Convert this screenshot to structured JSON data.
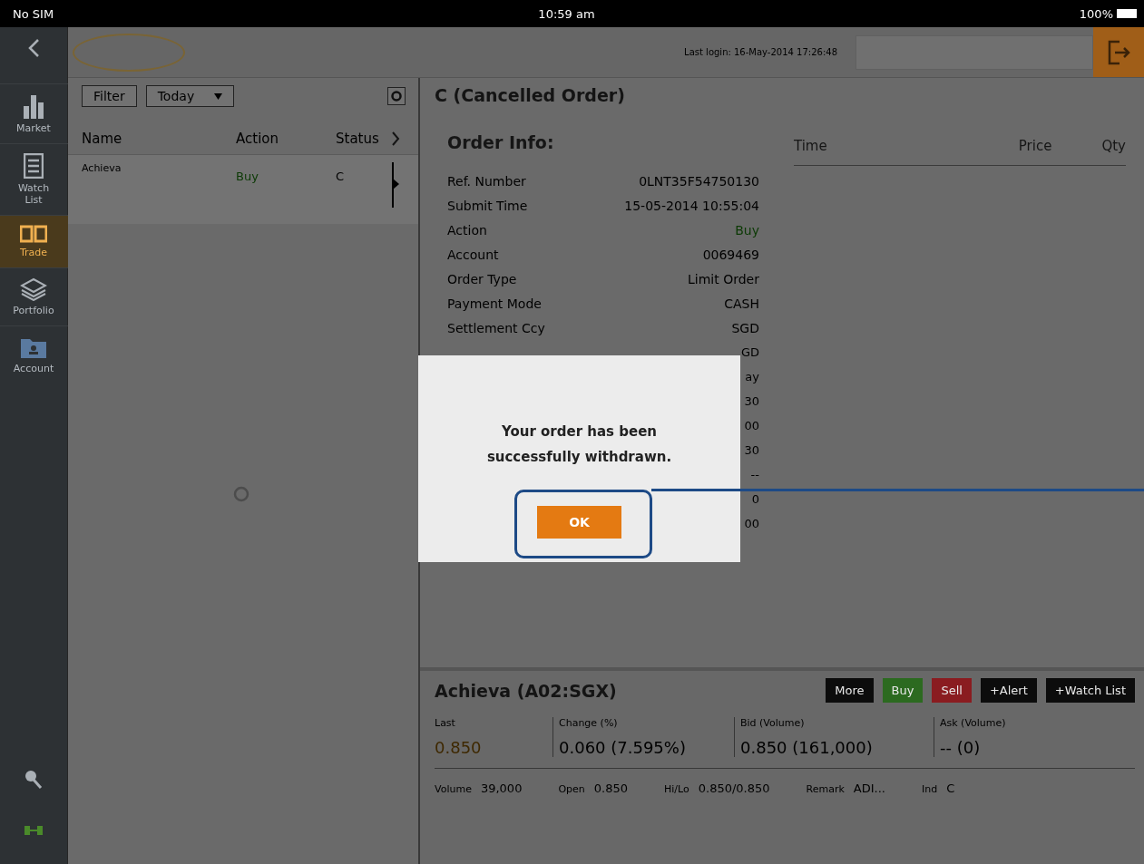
{
  "status_bar": {
    "carrier": "No SIM",
    "time": "10:59 am",
    "battery": "100%"
  },
  "sidebar": {
    "items": [
      {
        "label": "Market",
        "selected": false
      },
      {
        "label": "Watch List",
        "selected": false
      },
      {
        "label": "Trade",
        "selected": true
      },
      {
        "label": "Portfolio",
        "selected": false
      },
      {
        "label": "Account",
        "selected": false
      }
    ]
  },
  "header": {
    "last_login": "Last login: 16-May-2014 17:26:48"
  },
  "orders_panel": {
    "filter_button": "Filter",
    "period": "Today",
    "columns": [
      "Name",
      "Action",
      "Status"
    ],
    "rows": [
      {
        "name": "Achieva",
        "action": "Buy",
        "kind": "buy",
        "status": "C",
        "selected": true
      }
    ]
  },
  "order_detail": {
    "title": "C (Cancelled Order)",
    "section_title": "Order Info:",
    "fields": [
      {
        "label": "Ref. Number",
        "value": "0LNT35F54750130",
        "kind": "plain"
      },
      {
        "label": "Submit Time",
        "value": "15-05-2014 10:55:04",
        "kind": "plain"
      },
      {
        "label": "Action",
        "value": "Buy",
        "kind": "buy"
      },
      {
        "label": "Account",
        "value": "0069469",
        "kind": "plain"
      },
      {
        "label": "Order Type",
        "value": "Limit Order",
        "kind": "plain"
      },
      {
        "label": "Payment Mode",
        "value": "CASH",
        "kind": "plain"
      },
      {
        "label": "Settlement Ccy",
        "value": "SGD",
        "kind": "plain"
      }
    ],
    "covered_values": [
      "GD",
      "ay",
      "30",
      "00",
      "30",
      "--",
      "0",
      "00"
    ]
  },
  "fills_table": {
    "columns": [
      "Time",
      "Price",
      "Qty"
    ]
  },
  "quote": {
    "title": "Achieva (A02:SGX)",
    "buttons": [
      {
        "label": "More",
        "kind": "neutral"
      },
      {
        "label": "Buy",
        "kind": "buy"
      },
      {
        "label": "Sell",
        "kind": "sell"
      },
      {
        "label": "+Alert",
        "kind": "neutral"
      },
      {
        "label": "+Watch List",
        "kind": "neutral"
      }
    ],
    "stats": [
      {
        "label": "Last",
        "value": "0.850",
        "kind": "highlight"
      },
      {
        "label": "Change (%)",
        "value": "0.060 (7.595%)",
        "kind": "plain"
      },
      {
        "label": "Bid (Volume)",
        "value": "0.850 (161,000)",
        "kind": "plain"
      },
      {
        "label": "Ask (Volume)",
        "value": "-- (0)",
        "kind": "plain"
      }
    ],
    "details": [
      {
        "label": "Volume",
        "value": "39,000"
      },
      {
        "label": "Open",
        "value": "0.850"
      },
      {
        "label": "Hi/Lo",
        "value": "0.850/0.850"
      },
      {
        "label": "Remark",
        "value": "ADI..."
      },
      {
        "label": "Ind",
        "value": "C"
      }
    ]
  },
  "dialog": {
    "message": "Your order has been successfully withdrawn.",
    "ok_button": "OK"
  }
}
